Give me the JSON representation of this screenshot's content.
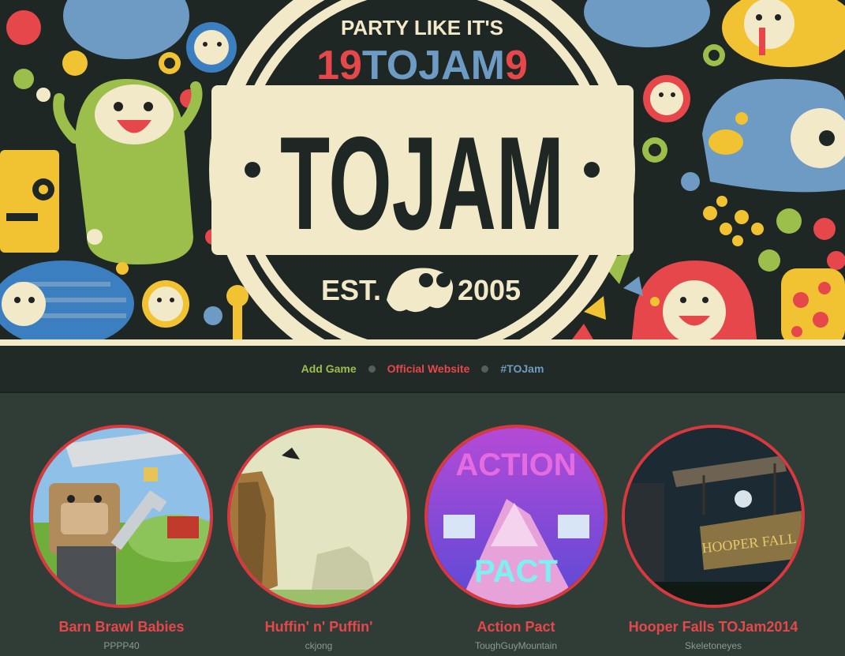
{
  "banner": {
    "tagline": "PARTY LIKE IT'S",
    "year_left": "19",
    "year_mid": "TOJAM",
    "year_right": "9",
    "logo": "TOJAM",
    "est_label": "EST.",
    "est_year": "2005"
  },
  "nav": {
    "links": [
      {
        "label": "Add Game",
        "color": "#9bbf4a"
      },
      {
        "label": "Official Website",
        "color": "#e5474a"
      },
      {
        "label": "#TOJam",
        "color": "#6f9bbd"
      }
    ]
  },
  "games": [
    {
      "title": "Barn Brawl Babies",
      "author": "PPPP40"
    },
    {
      "title": "Huffin' n' Puffin'",
      "author": "ckjong"
    },
    {
      "title": "Action Pact",
      "author": "ToughGuyMountain"
    },
    {
      "title": "Hooper Falls TOJam2014",
      "author": "Skeletoneyes"
    }
  ],
  "thumbs": {
    "action_pact_top": "ACTION",
    "action_pact_bottom": "PACT",
    "hooper_sign": "HOOPER FALL"
  }
}
